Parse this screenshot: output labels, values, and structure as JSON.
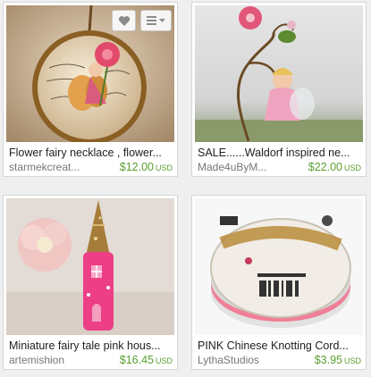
{
  "listings": [
    {
      "title": "Flower fairy necklace , flower...",
      "shop": "starmekcreat...",
      "price": "$12.00",
      "currency": "USD"
    },
    {
      "title": "SALE......Waldorf inspired ne...",
      "shop": "Made4uByM...",
      "price": "$22.00",
      "currency": "USD"
    },
    {
      "title": "Miniature fairy tale pink hous...",
      "shop": "artemishion",
      "price": "$16.45",
      "currency": "USD"
    },
    {
      "title": "PINK Chinese Knotting Cord...",
      "shop": "LythaStudios",
      "price": "$3.95",
      "currency": "USD"
    }
  ],
  "overlay_icons": [
    "heart-icon",
    "list-icon"
  ],
  "colors": {
    "price": "#5a9e2f",
    "shop": "#777777",
    "title": "#222222"
  }
}
